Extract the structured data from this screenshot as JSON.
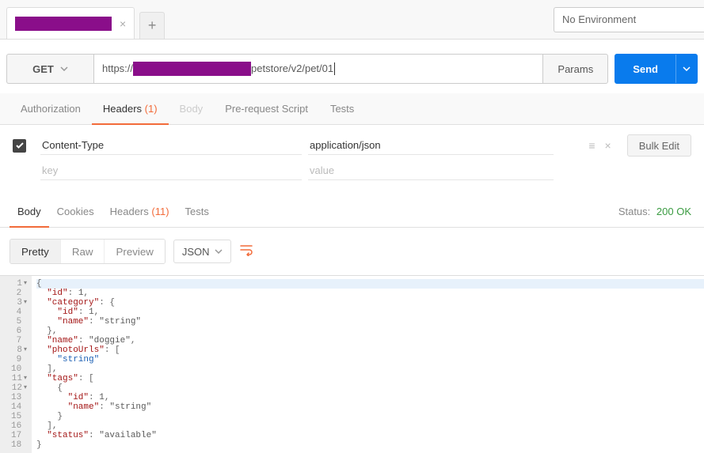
{
  "env": {
    "label": "No Environment"
  },
  "request": {
    "method": "GET",
    "url_prefix": "https://",
    "url_suffix": "petstore/v2/pet/01",
    "params_label": "Params",
    "send_label": "Send"
  },
  "req_tabs": {
    "authorization": "Authorization",
    "headers": "Headers",
    "headers_count": "(1)",
    "body": "Body",
    "prerequest": "Pre-request Script",
    "tests": "Tests"
  },
  "headers": {
    "rows": [
      {
        "key": "Content-Type",
        "value": "application/json"
      }
    ],
    "key_placeholder": "key",
    "value_placeholder": "value",
    "bulk_edit": "Bulk Edit"
  },
  "resp_tabs": {
    "body": "Body",
    "cookies": "Cookies",
    "headers": "Headers",
    "headers_count": "(11)",
    "tests": "Tests"
  },
  "status": {
    "label": "Status:",
    "code": "200 OK"
  },
  "viewer": {
    "pretty": "Pretty",
    "raw": "Raw",
    "preview": "Preview",
    "format": "JSON"
  },
  "lines": [
    "{",
    "  \"id\": 1,",
    "  \"category\": {",
    "    \"id\": 1,",
    "    \"name\": \"string\"",
    "  },",
    "  \"name\": \"doggie\",",
    "  \"photoUrls\": [",
    "    \"string\"",
    "  ],",
    "  \"tags\": [",
    "    {",
    "      \"id\": 1,",
    "      \"name\": \"string\"",
    "    }",
    "  ],",
    "  \"status\": \"available\"",
    "}"
  ]
}
